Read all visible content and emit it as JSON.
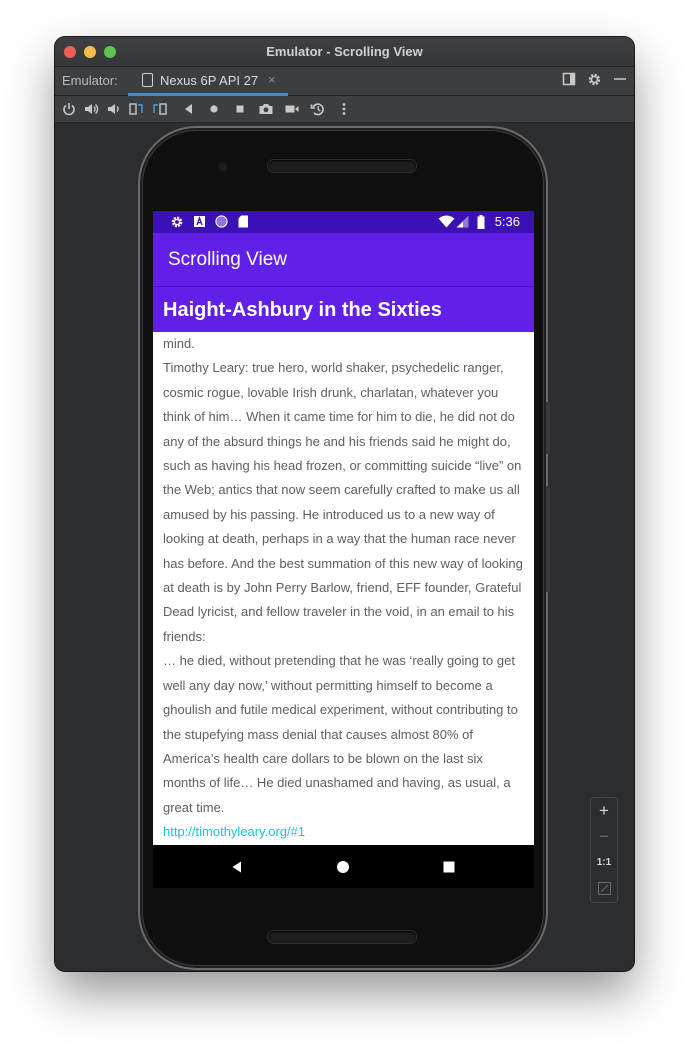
{
  "window": {
    "title": "Emulator - Scrolling View"
  },
  "tabbar": {
    "label": "Emulator:",
    "device_tab": "Nexus 6P API 27",
    "close_glyph": "×"
  },
  "toolbar": {
    "icons": [
      "power-icon",
      "volume-up-icon",
      "volume-down-icon",
      "rotate-left-icon",
      "rotate-right-icon",
      "back-icon",
      "home-icon",
      "overview-icon",
      "screenshot-icon",
      "record-icon",
      "snapshot-icon",
      "more-icon"
    ]
  },
  "status_bar": {
    "time": "5:36",
    "icons": [
      "settings-icon",
      "a-icon",
      "circle-icon",
      "sd-card-icon",
      "wifi-icon",
      "signal-icon",
      "battery-icon"
    ]
  },
  "app_bar": {
    "title": "Scrolling View"
  },
  "article": {
    "heading": "Haight-Ashbury in the Sixties",
    "paragraphs": [
      "mind.",
      "Timothy Leary: true hero, world shaker, psychedelic ranger, cosmic rogue, lovable Irish drunk, charlatan, whatever you think of him… When it came time for him to die, he did not do any of the absurd things he and his friends said he might do, such as having his head frozen, or committing suicide “live” on the Web; antics that now seem carefully crafted to make us all amused by his passing. He introduced us to a new way of looking at death, perhaps in a way that the human race never has before. And the best summation of this new way of looking at death is by John Perry Barlow, friend, EFF founder, Grateful Dead lyricist, and fellow traveler in the void, in an email to his friends:",
      "… he died, without pretending that he was ‘really going to get well any day now,’ without permitting himself to become a ghoulish and futile medical experiment, without contributing to the stupefying mass denial that causes almost 80% of America’s health care dollars to be blown on the last six months of life… He died unashamed and having, as usual, a great time."
    ],
    "link": "http://timothyleary.org/#1"
  },
  "zoom": {
    "plus": "+",
    "minus": "−",
    "one_to_one": "1:1"
  },
  "colors": {
    "status_bar": "#3b10b4",
    "app_bar": "#6120e7",
    "link": "#19c3d8",
    "body_text": "#5f5f5f"
  }
}
